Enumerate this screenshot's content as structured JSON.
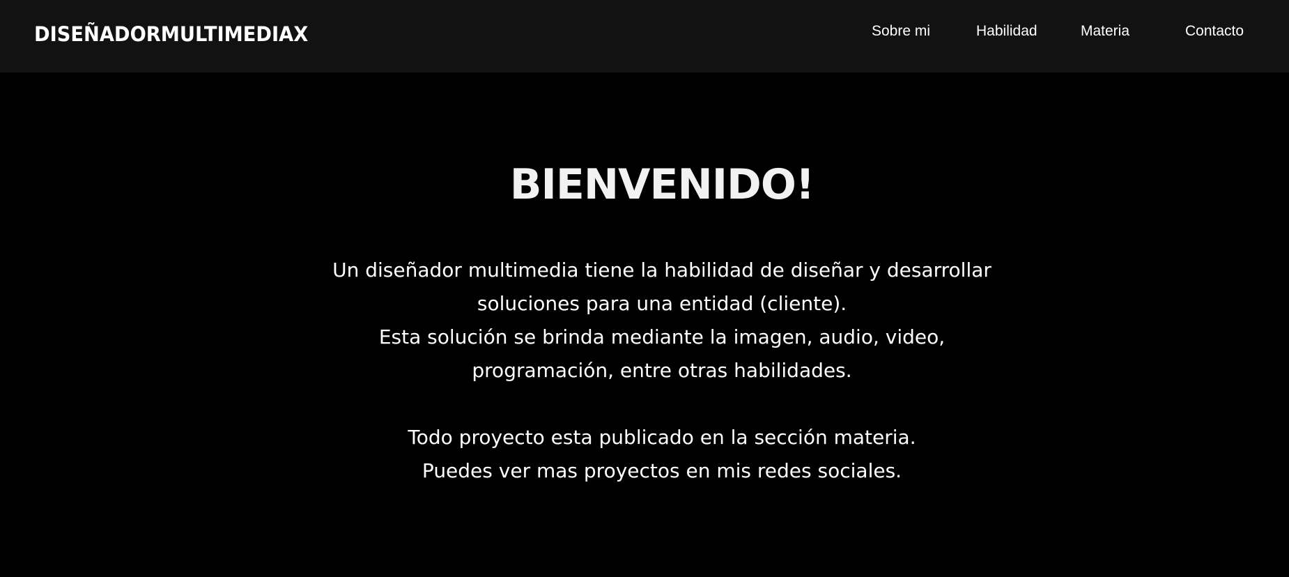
{
  "header": {
    "logo": "DISEÑADORMULTIMEDIAX",
    "nav": {
      "sobre_mi": "Sobre mi",
      "habilidad": "Habilidad",
      "materia": "Materia",
      "contacto": "Contacto"
    }
  },
  "hero": {
    "title": "BIENVENIDO!",
    "lines": [
      "Un diseñador multimedia tiene la habilidad de diseñar y desarrollar",
      "soluciones para una entidad (cliente).",
      "Esta solución se brinda mediante la imagen, audio, video,",
      "programación, entre otras habilidades.",
      "",
      "Todo proyecto esta publicado en la sección materia.",
      "Puedes ver mas proyectos en mis redes sociales."
    ]
  },
  "colors": {
    "background": "#000000",
    "navbar": "#121212",
    "text": "#ffffff"
  }
}
